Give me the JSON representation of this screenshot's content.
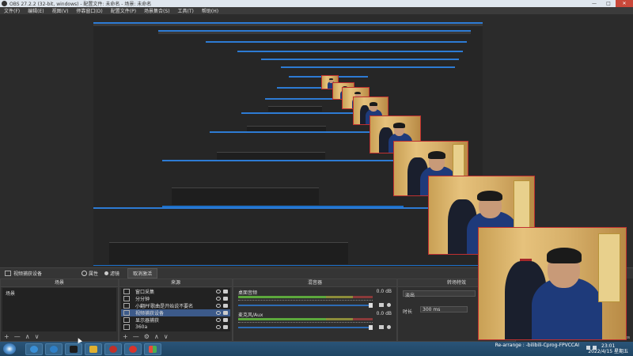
{
  "window": {
    "title": "OBS 27.2.2 (32-bit, windows) - 配置文件: 未命名 - 场景: 未命名"
  },
  "window_controls": [
    "—",
    "□",
    "✕"
  ],
  "menu": [
    "文件(F)",
    "编辑(E)",
    "视图(V)",
    "停靠窗口(D)",
    "配置文件(P)",
    "场景集合(S)",
    "工具(T)",
    "帮助(H)"
  ],
  "toolbar": {
    "source_name": "视频捕获设备",
    "properties": "属性",
    "filters": "滤镜",
    "deactivate": "取消激活"
  },
  "scenes": {
    "header": "场景",
    "items": [
      "场景"
    ],
    "footer": [
      "+",
      "—",
      "∧",
      "∨"
    ]
  },
  "sources": {
    "header": "来源",
    "items": [
      {
        "label": "窗口采集",
        "icon": "window-icon"
      },
      {
        "label": "分分钟",
        "icon": "text-icon"
      },
      {
        "label": "小翻PF歌曲是开始说不要名",
        "icon": "text-icon"
      },
      {
        "label": "视频捕获设备",
        "icon": "camera-icon",
        "selected": true
      },
      {
        "label": "显示器捕获",
        "icon": "monitor-icon"
      },
      {
        "label": "360a",
        "icon": "image-icon"
      }
    ],
    "footer": [
      "+",
      "—",
      "⚙",
      "∧",
      "∨"
    ]
  },
  "mixer": {
    "header": "混音器",
    "channels": [
      {
        "name": "桌面音频",
        "db": "0.0 dB"
      },
      {
        "name": "麦克风/Aux",
        "db": "0.0 dB"
      }
    ]
  },
  "transitions": {
    "header": "转场特效",
    "type": "淡出",
    "duration_label": "时长",
    "duration_value": "300 ms"
  },
  "status": {
    "text": "Re-arrange  ·  LIVE: 00:00:00  REC: 00:00:00  CPU: 2.3%, 30.00 fps"
  },
  "taskbar": {
    "caption": "Re-arrange : -bilibili-Cprog-FPVCCAI",
    "time": "23:01",
    "date": "2022/4/15 星期五"
  },
  "colors": {
    "accent": "#2d7bd4",
    "title_bar": "#dfe6ee",
    "panel": "#2f2f2f",
    "taskbar": "#245071",
    "meter_green": "#5ca83c"
  }
}
